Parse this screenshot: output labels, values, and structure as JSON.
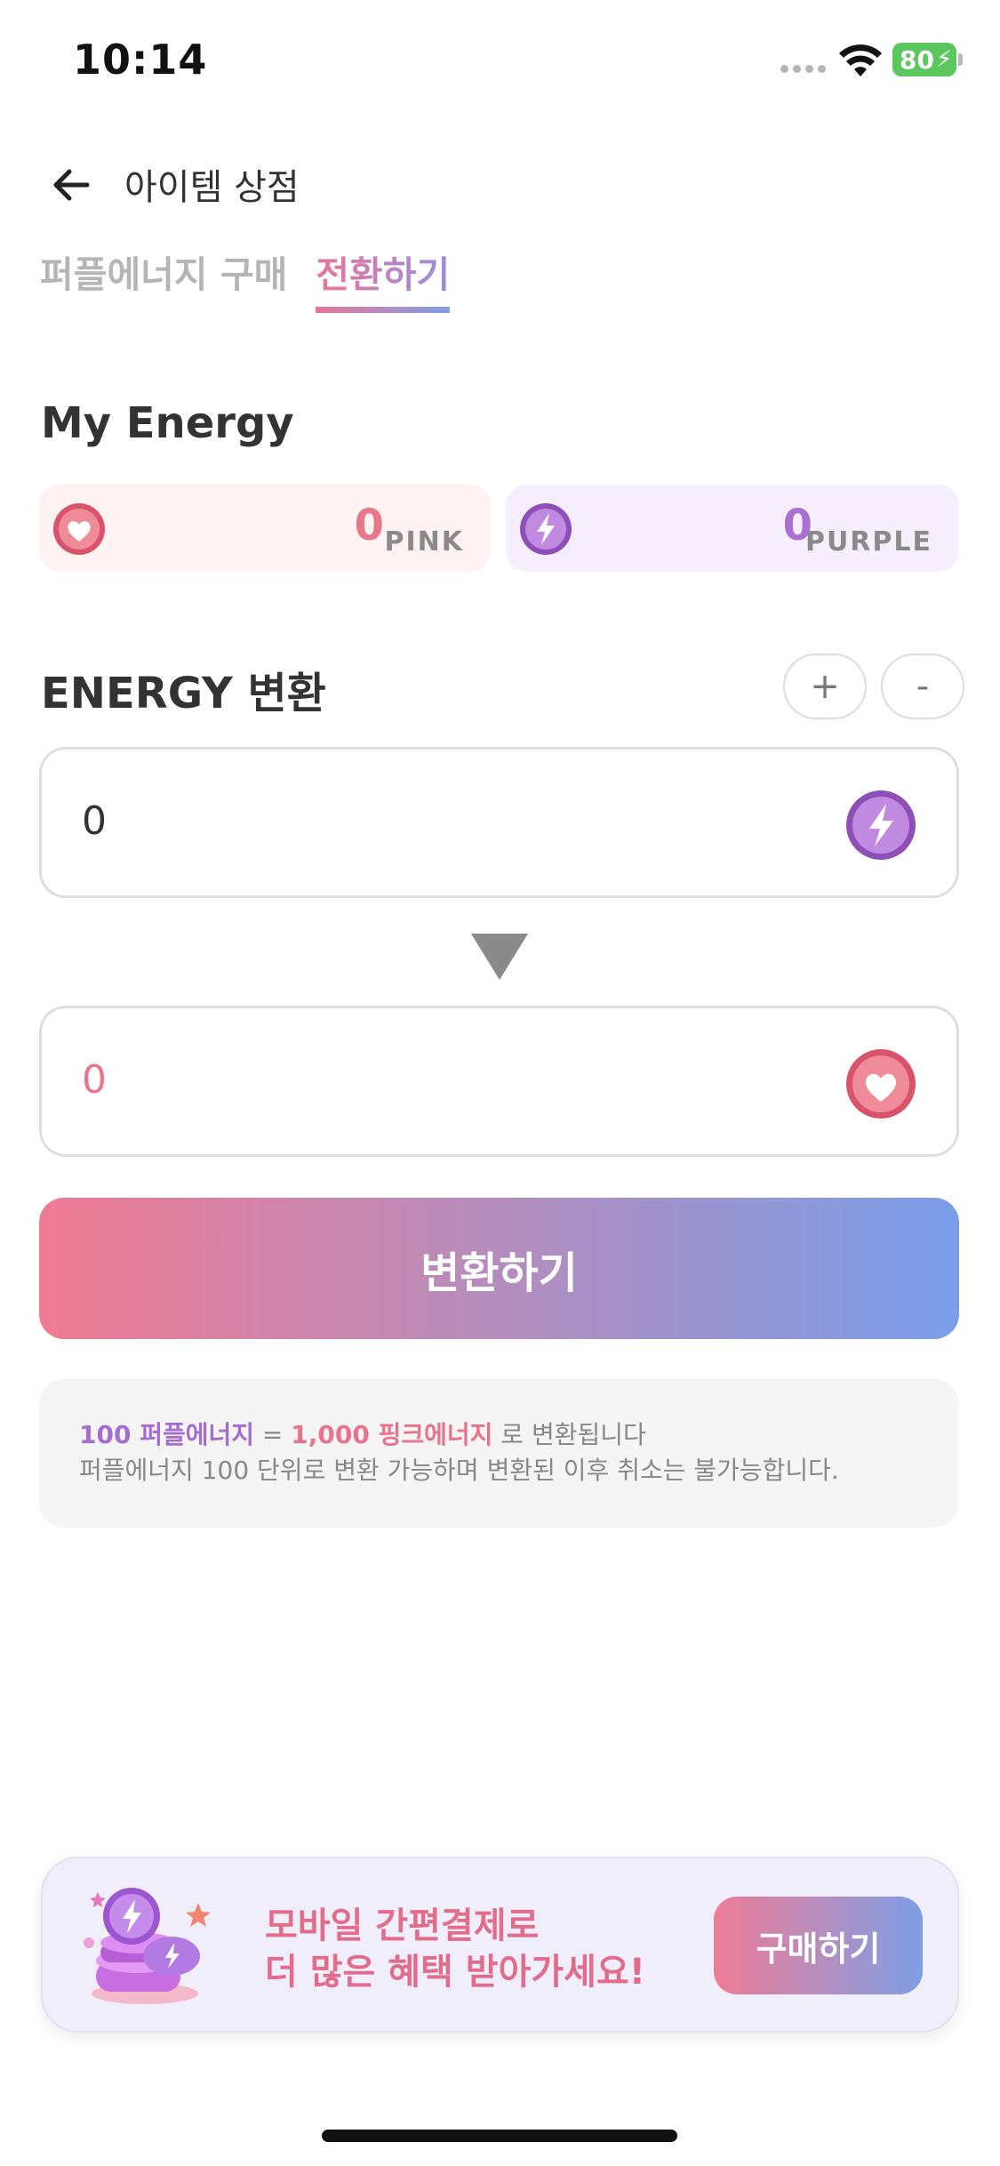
{
  "status_bar": {
    "time": "10:14",
    "battery": "80"
  },
  "header": {
    "title": "아이템 상점"
  },
  "tabs": [
    {
      "label": "퍼플에너지 구매",
      "active": false
    },
    {
      "label": "전환하기",
      "active": true
    }
  ],
  "my_energy": {
    "title": "My Energy",
    "pink": {
      "amount": "0",
      "unit": "PINK"
    },
    "purple": {
      "amount": "0",
      "unit": "PURPLE"
    }
  },
  "conversion": {
    "title": "ENERGY 변환",
    "plus_label": "+",
    "minus_label": "-",
    "from_value": "0",
    "to_value": "0",
    "button_label": "변환하기"
  },
  "info": {
    "purple_amount": "100 퍼플에너지",
    "equals": " = ",
    "pink_amount": "1,000 핑크에너지",
    "suffix": " 로 변환됩니다",
    "note": "퍼플에너지 100 단위로 변환 가능하며 변환된 이후 취소는 불가능합니다."
  },
  "banner": {
    "line1": "모바일 간편결제로",
    "line2": "더 많은 혜택 받아가세요!",
    "button_label": "구매하기"
  },
  "colors": {
    "pink": "#e8778a",
    "purple": "#a871d1",
    "gradient_start": "#ef7b93",
    "gradient_end": "#7a9ee9"
  },
  "icons": [
    "back-arrow-icon",
    "heart-icon",
    "lightning-icon",
    "wifi-icon",
    "triangle-down-icon"
  ]
}
